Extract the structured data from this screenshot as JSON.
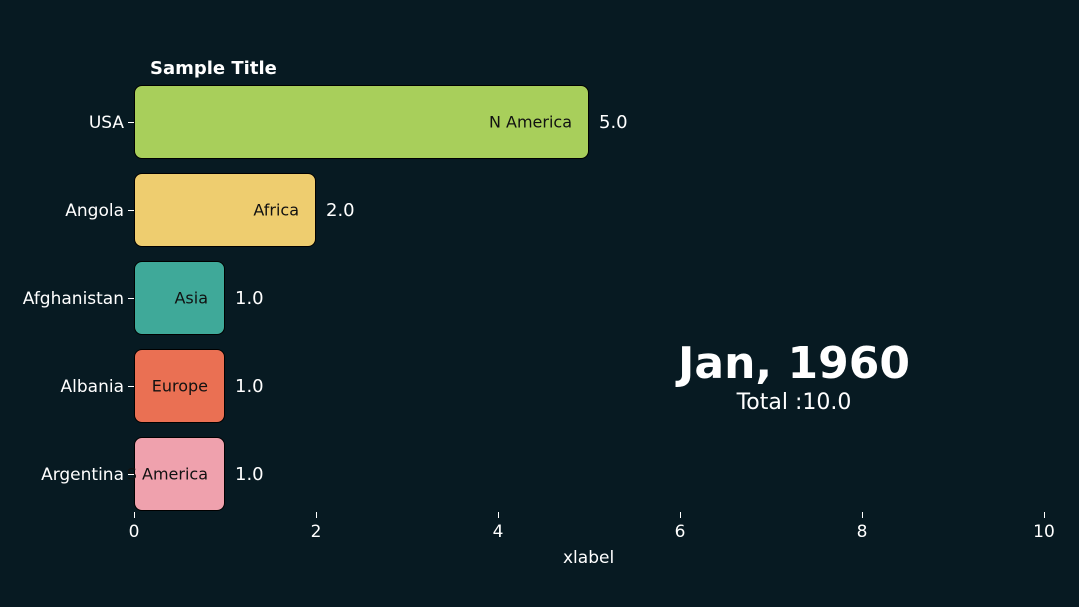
{
  "chart_data": {
    "type": "bar",
    "orientation": "horizontal",
    "title": "Sample Title",
    "xlabel": "xlabel",
    "ylabel": "",
    "xlim": [
      0,
      10
    ],
    "xticks": [
      0,
      2,
      4,
      6,
      8,
      10
    ],
    "categories": [
      "USA",
      "Angola",
      "Afghanistan",
      "Albania",
      "Argentina"
    ],
    "values": [
      5.0,
      2.0,
      1.0,
      1.0,
      1.0
    ],
    "bar_labels": [
      "N America",
      "Africa",
      "Asia",
      "Europe",
      "S America"
    ],
    "value_labels": [
      "5.0",
      "2.0",
      "1.0",
      "1.0",
      "1.0"
    ],
    "colors": [
      "#a8cf5b",
      "#eecd6f",
      "#3fa999",
      "#ea7053",
      "#efa1ad"
    ],
    "period": "Jan, 1960",
    "total_label": "Total :10.0"
  }
}
